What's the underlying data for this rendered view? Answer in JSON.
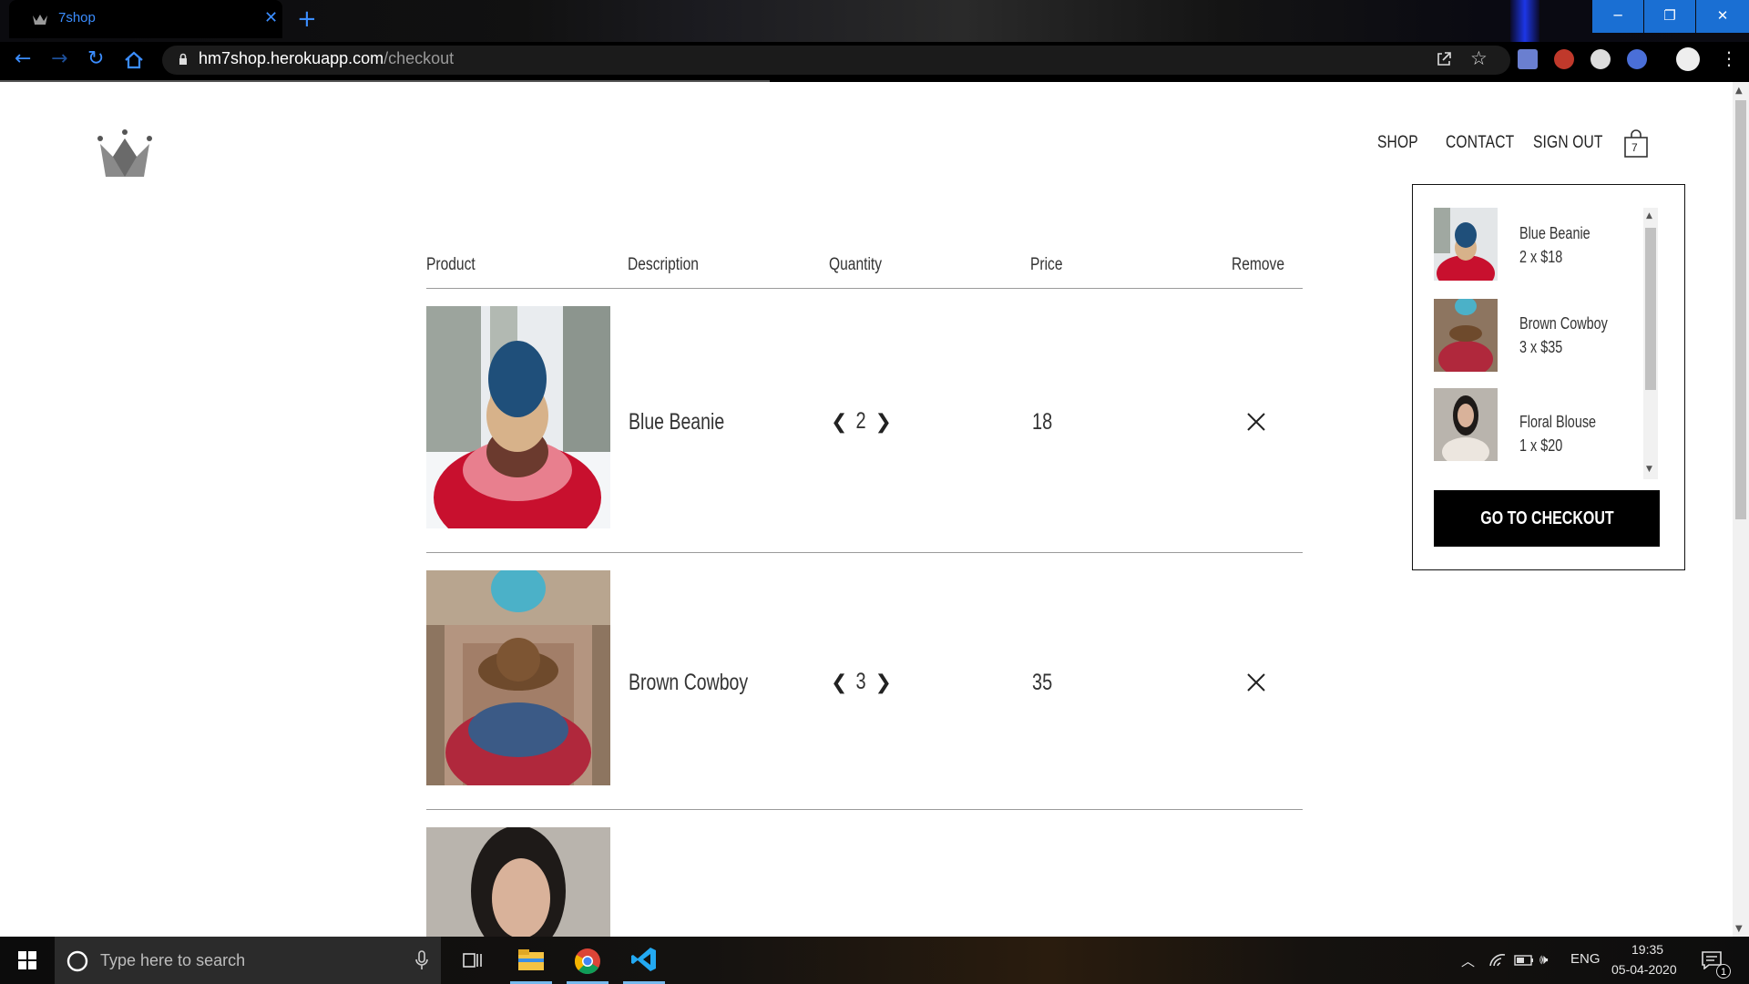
{
  "browser": {
    "tab_title": "7shop",
    "url_domain": "hm7shop.herokuapp.com",
    "url_path": "/checkout",
    "accent": "#3b8dff"
  },
  "header": {
    "nav": [
      "SHOP",
      "CONTACT",
      "SIGN OUT"
    ],
    "cart_count": "7"
  },
  "table": {
    "columns": [
      "Product",
      "Description",
      "Quantity",
      "Price",
      "Remove"
    ],
    "rows": [
      {
        "description": "Blue Beanie",
        "quantity": "2",
        "price": "18"
      },
      {
        "description": "Brown Cowboy",
        "quantity": "3",
        "price": "35"
      }
    ]
  },
  "cart_dropdown": {
    "items": [
      {
        "name": "Blue Beanie",
        "qty_price": "2 x $18"
      },
      {
        "name": "Brown Cowboy",
        "qty_price": "3 x $35"
      },
      {
        "name": "Floral Blouse",
        "qty_price": "1 x $20"
      }
    ],
    "checkout_label": "GO TO CHECKOUT"
  },
  "taskbar": {
    "search_placeholder": "Type here to search",
    "language": "ENG",
    "time": "19:35",
    "date": "05-04-2020",
    "notification_count": "1"
  },
  "icons": {
    "back": "back-arrow-icon",
    "forward": "forward-arrow-icon",
    "reload": "reload-icon",
    "home": "home-icon",
    "logo": "crown-logo-icon",
    "cart": "shopping-bag-icon",
    "remove": "close-icon"
  }
}
